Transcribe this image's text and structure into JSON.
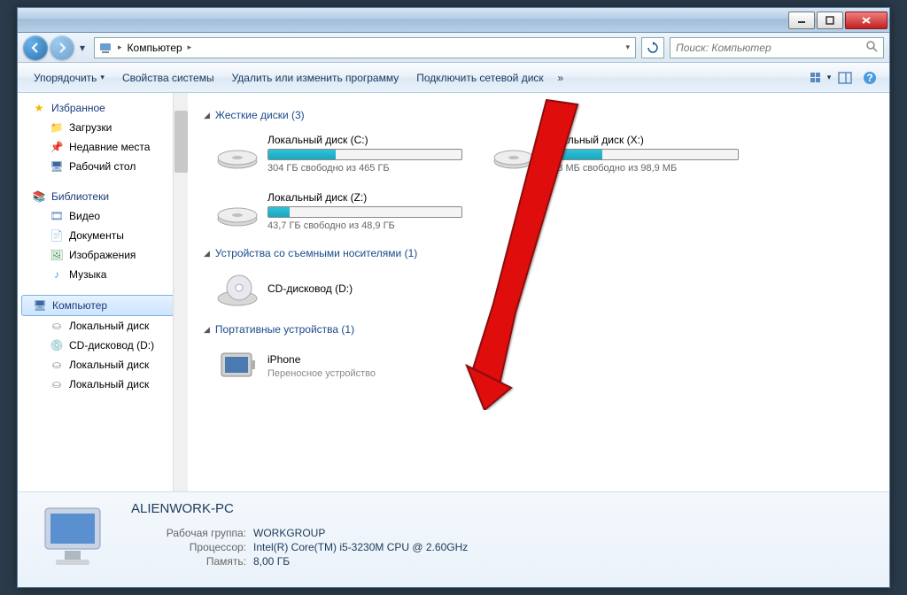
{
  "breadcrumb": {
    "location": "Компьютер"
  },
  "search": {
    "placeholder": "Поиск: Компьютер"
  },
  "toolbar": {
    "organize": "Упорядочить",
    "properties": "Свойства системы",
    "uninstall": "Удалить или изменить программу",
    "map_drive": "Подключить сетевой диск"
  },
  "sidebar": {
    "favorites": {
      "label": "Избранное",
      "items": [
        {
          "label": "Загрузки"
        },
        {
          "label": "Недавние места"
        },
        {
          "label": "Рабочий стол"
        }
      ]
    },
    "libraries": {
      "label": "Библиотеки",
      "items": [
        {
          "label": "Видео"
        },
        {
          "label": "Документы"
        },
        {
          "label": "Изображения"
        },
        {
          "label": "Музыка"
        }
      ]
    },
    "computer": {
      "label": "Компьютер",
      "items": [
        {
          "label": "Локальный диск"
        },
        {
          "label": "CD-дисковод (D:)"
        },
        {
          "label": "Локальный диск"
        },
        {
          "label": "Локальный диск"
        }
      ]
    }
  },
  "sections": {
    "hdd": {
      "title": "Жесткие диски (3)"
    },
    "removable": {
      "title": "Устройства со съемными носителями (1)"
    },
    "portable": {
      "title": "Портативные устройства (1)"
    }
  },
  "drives": {
    "c": {
      "name": "Локальный диск (C:)",
      "free": "304 ГБ свободно из 465 ГБ",
      "pct": 35
    },
    "x": {
      "name": "Локальный диск (X:)",
      "free": "69,8 МБ свободно из 98,9 МБ",
      "pct": 30
    },
    "z": {
      "name": "Локальный диск (Z:)",
      "free": "43,7 ГБ свободно из 48,9 ГБ",
      "pct": 11
    },
    "d": {
      "name": "CD-дисковод (D:)"
    },
    "iphone": {
      "name": "iPhone",
      "type": "Переносное устройство"
    }
  },
  "details": {
    "name": "ALIENWORK-PC",
    "workgroup_label": "Рабочая группа:",
    "workgroup": "WORKGROUP",
    "cpu_label": "Процессор:",
    "cpu": "Intel(R) Core(TM) i5-3230M CPU @ 2.60GHz",
    "ram_label": "Память:",
    "ram": "8,00 ГБ"
  }
}
